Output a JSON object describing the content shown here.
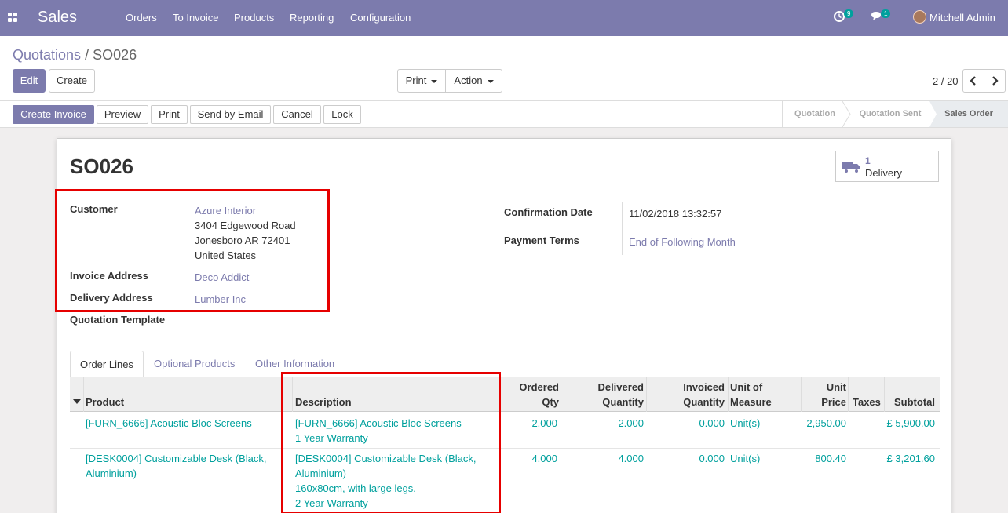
{
  "topbar": {
    "app_name": "Sales",
    "menu": [
      "Orders",
      "To Invoice",
      "Products",
      "Reporting",
      "Configuration"
    ],
    "activity_badge": "9",
    "messages_badge": "1",
    "user_name": "Mitchell Admin"
  },
  "breadcrumb": {
    "parent": "Quotations",
    "sep": "/",
    "current": "SO026"
  },
  "buttons": {
    "edit": "Edit",
    "create": "Create",
    "print": "Print",
    "action": "Action"
  },
  "pager": {
    "value": "2 / 20"
  },
  "status_actions": [
    "Create Invoice",
    "Preview",
    "Print",
    "Send by Email",
    "Cancel",
    "Lock"
  ],
  "stages": [
    "Quotation",
    "Quotation Sent",
    "Sales Order"
  ],
  "record": {
    "name": "SO026",
    "smart_button": {
      "count": "1",
      "label": "Delivery"
    },
    "customer_label": "Customer",
    "customer_name": "Azure Interior",
    "customer_addr1": "3404 Edgewood Road",
    "customer_addr2": "Jonesboro AR 72401",
    "customer_addr3": "United States",
    "invoice_address_label": "Invoice Address",
    "invoice_address": "Deco Addict",
    "delivery_address_label": "Delivery Address",
    "delivery_address": "Lumber Inc",
    "quotation_template_label": "Quotation Template",
    "confirmation_date_label": "Confirmation Date",
    "confirmation_date": "11/02/2018 13:32:57",
    "payment_terms_label": "Payment Terms",
    "payment_terms": "End of Following Month"
  },
  "tabs": [
    "Order Lines",
    "Optional Products",
    "Other Information"
  ],
  "table": {
    "headers": {
      "product": "Product",
      "description": "Description",
      "ordered_qty_1": "Ordered",
      "ordered_qty_2": "Qty",
      "delivered_1": "Delivered",
      "delivered_2": "Quantity",
      "invoiced_1": "Invoiced",
      "invoiced_2": "Quantity",
      "uom_1": "Unit of",
      "uom_2": "Measure",
      "price_1": "Unit",
      "price_2": "Price",
      "taxes": "Taxes",
      "subtotal": "Subtotal"
    },
    "rows": [
      {
        "product_1": "[FURN_6666] Acoustic Bloc Screens",
        "product_2": "",
        "desc_1": "[FURN_6666] Acoustic Bloc Screens",
        "desc_2": "1 Year Warranty",
        "desc_3": "",
        "desc_4": "",
        "ordered": "2.000",
        "delivered": "2.000",
        "invoiced": "0.000",
        "uom": "Unit(s)",
        "price": "2,950.00",
        "subtotal": "£ 5,900.00"
      },
      {
        "product_1": "[DESK0004] Customizable Desk (Black,",
        "product_2": "Aluminium)",
        "desc_1": "[DESK0004] Customizable Desk (Black,",
        "desc_2": "Aluminium)",
        "desc_3": "160x80cm, with large legs.",
        "desc_4": "2 Year Warranty",
        "ordered": "4.000",
        "delivered": "4.000",
        "invoiced": "0.000",
        "uom": "Unit(s)",
        "price": "800.40",
        "subtotal": "£ 3,201.60"
      }
    ]
  },
  "colors": {
    "brand": "#7c7bad",
    "link_teal": "#00a09d",
    "highlight_red": "#e60000"
  }
}
